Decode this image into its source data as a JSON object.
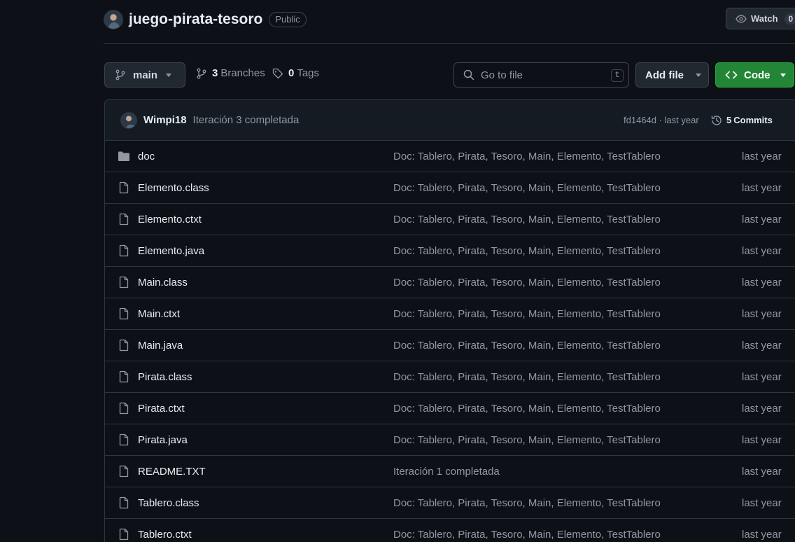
{
  "repo": {
    "name": "juego-pirata-tesoro",
    "visibility": "Public",
    "watch_label": "Watch",
    "watch_count": "0"
  },
  "toolbar": {
    "branch": "main",
    "branches_count": "3",
    "branches_label": "Branches",
    "tags_count": "0",
    "tags_label": "Tags",
    "search_placeholder": "Go to file",
    "search_shortcut": "t",
    "add_file_label": "Add file",
    "code_label": "Code"
  },
  "commit": {
    "author": "Wimpi18",
    "message": "Iteración 3 completada",
    "meta": "fd1464d · last year",
    "commits_count": "5",
    "commits_label": "Commits"
  },
  "files": [
    {
      "name": "doc",
      "type": "folder",
      "message": "Doc: Tablero, Pirata, Tesoro, Main, Elemento, TestTablero",
      "date": "last year"
    },
    {
      "name": "Elemento.class",
      "type": "file",
      "message": "Doc: Tablero, Pirata, Tesoro, Main, Elemento, TestTablero",
      "date": "last year"
    },
    {
      "name": "Elemento.ctxt",
      "type": "file",
      "message": "Doc: Tablero, Pirata, Tesoro, Main, Elemento, TestTablero",
      "date": "last year"
    },
    {
      "name": "Elemento.java",
      "type": "file",
      "message": "Doc: Tablero, Pirata, Tesoro, Main, Elemento, TestTablero",
      "date": "last year"
    },
    {
      "name": "Main.class",
      "type": "file",
      "message": "Doc: Tablero, Pirata, Tesoro, Main, Elemento, TestTablero",
      "date": "last year"
    },
    {
      "name": "Main.ctxt",
      "type": "file",
      "message": "Doc: Tablero, Pirata, Tesoro, Main, Elemento, TestTablero",
      "date": "last year"
    },
    {
      "name": "Main.java",
      "type": "file",
      "message": "Doc: Tablero, Pirata, Tesoro, Main, Elemento, TestTablero",
      "date": "last year"
    },
    {
      "name": "Pirata.class",
      "type": "file",
      "message": "Doc: Tablero, Pirata, Tesoro, Main, Elemento, TestTablero",
      "date": "last year"
    },
    {
      "name": "Pirata.ctxt",
      "type": "file",
      "message": "Doc: Tablero, Pirata, Tesoro, Main, Elemento, TestTablero",
      "date": "last year"
    },
    {
      "name": "Pirata.java",
      "type": "file",
      "message": "Doc: Tablero, Pirata, Tesoro, Main, Elemento, TestTablero",
      "date": "last year"
    },
    {
      "name": "README.TXT",
      "type": "file",
      "message": "Iteración 1 completada",
      "date": "last year"
    },
    {
      "name": "Tablero.class",
      "type": "file",
      "message": "Doc: Tablero, Pirata, Tesoro, Main, Elemento, TestTablero",
      "date": "last year"
    },
    {
      "name": "Tablero.ctxt",
      "type": "file",
      "message": "Doc: Tablero, Pirata, Tesoro, Main, Elemento, TestTablero",
      "date": "last year"
    }
  ],
  "colors": {
    "background": "#0d1117",
    "accent_green": "#238636",
    "muted_text": "#9198a1",
    "border": "#30363d"
  }
}
